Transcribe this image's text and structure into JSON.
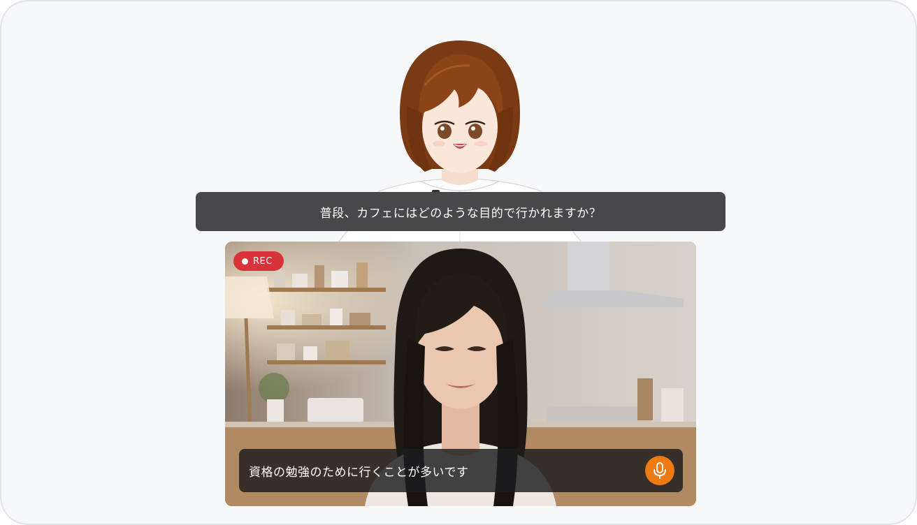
{
  "question": {
    "text": "普段、カフェにはどのような目的で行かれますか？"
  },
  "camera": {
    "rec_label": "REC",
    "answer_text": "資格の勉強のために行くことが多いです",
    "mic_icon": "microphone-icon"
  },
  "colors": {
    "frame_bg": "#f7f8fa",
    "caption_bg": "#48484a",
    "rec_red": "#d8333a",
    "mic_orange": "#f07a12"
  }
}
